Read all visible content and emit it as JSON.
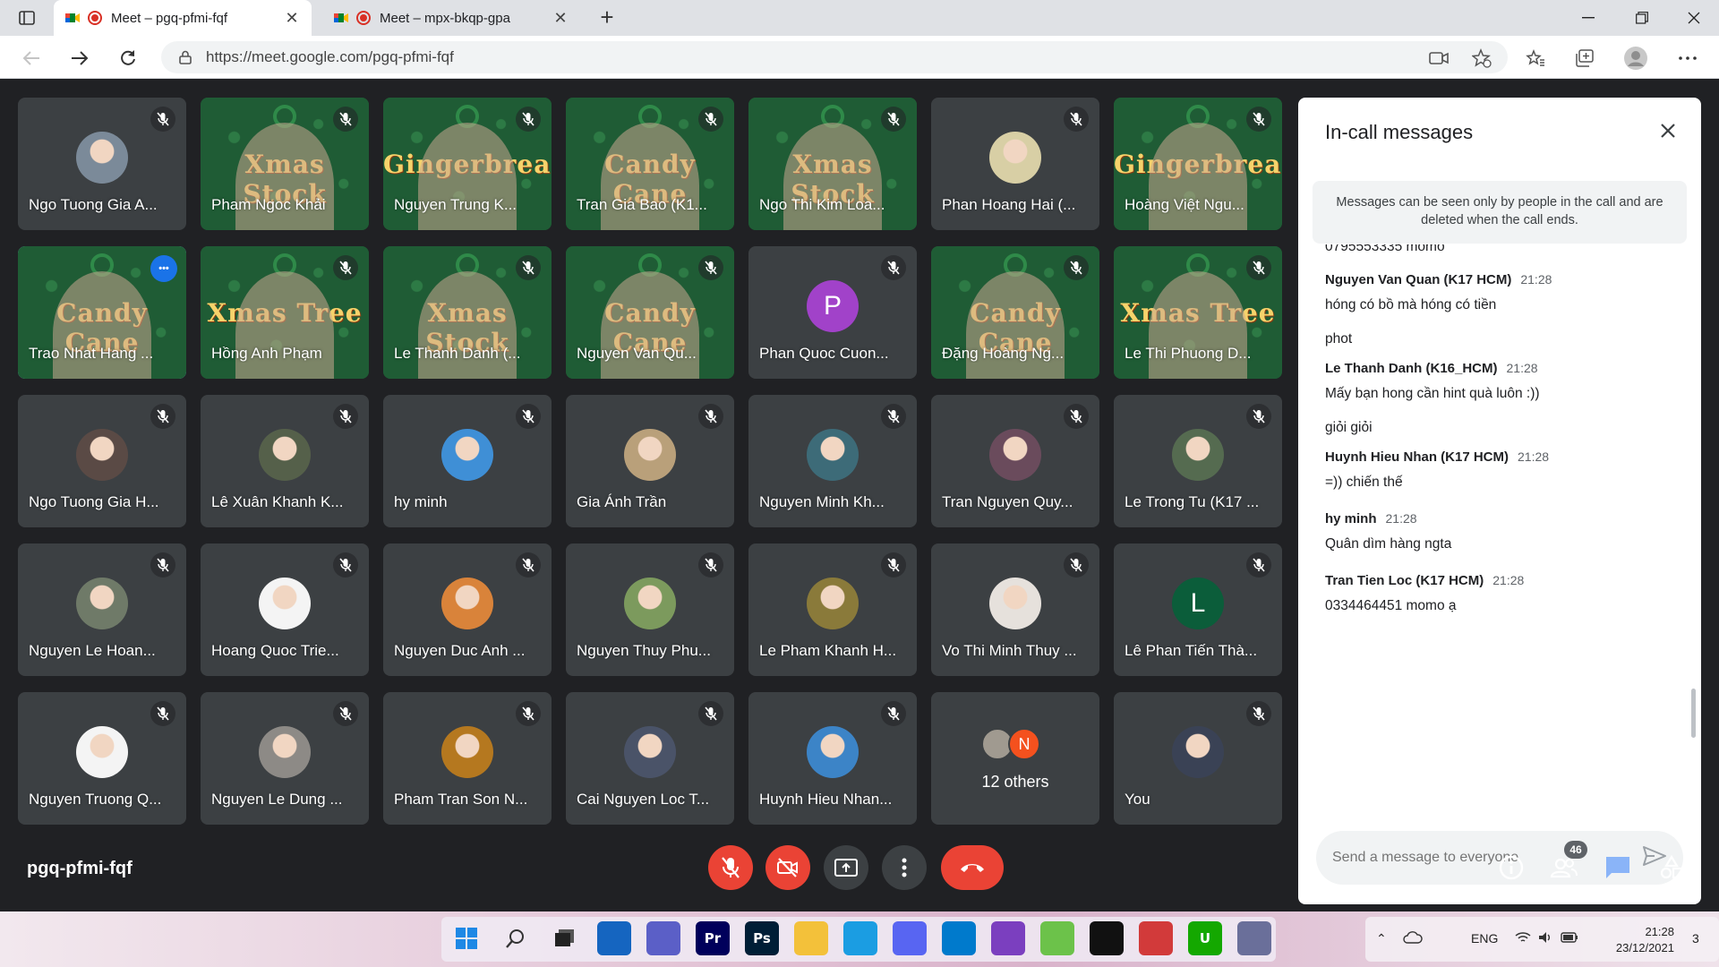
{
  "browser": {
    "tabs": [
      {
        "title": "Meet – pgq-pfmi-fqf",
        "active": true
      },
      {
        "title": "Meet – mpx-bkqp-gpa",
        "active": false
      }
    ],
    "url": "https://meet.google.com/pgq-pfmi-fqf"
  },
  "meeting": {
    "code": "pgq-pfmi-fqf",
    "participant_count": "46",
    "tiles": [
      {
        "name": "Ngo Tuong Gia A...",
        "type": "avatar",
        "color": "#7b8a99"
      },
      {
        "name": "Pham Ngoc Khải",
        "type": "video",
        "banner": "Xmas Stock"
      },
      {
        "name": "Nguyen Trung K...",
        "type": "video",
        "banner": "Gingerbread"
      },
      {
        "name": "Tran Gia Bao (K1...",
        "type": "video",
        "banner": "Candy Cane"
      },
      {
        "name": "Ngo Thi Kim Loa...",
        "type": "video",
        "banner": "Xmas Stock"
      },
      {
        "name": "Phan Hoang Hai (...",
        "type": "avatar",
        "color": "#d8cfa5"
      },
      {
        "name": "Hoàng Việt Ngu...",
        "type": "video",
        "banner": "Gingerbread"
      },
      {
        "name": "Trao Nhat Hang ...",
        "type": "video",
        "banner": "Candy Cane",
        "selected": true
      },
      {
        "name": "Hồng Anh Phạm",
        "type": "video",
        "banner": "Xmas Tree"
      },
      {
        "name": "Le Thanh Danh (...",
        "type": "video",
        "banner": "Xmas Stock"
      },
      {
        "name": "Nguyen Van Qu...",
        "type": "video",
        "banner": "Candy Cane"
      },
      {
        "name": "Phan Quoc Cuon...",
        "type": "letter",
        "letter": "P",
        "color": "#a142c9"
      },
      {
        "name": "Đặng Hoàng Ng...",
        "type": "video",
        "banner": "Candy Cane"
      },
      {
        "name": "Le Thi Phuong D...",
        "type": "video",
        "banner": "Xmas Tree"
      },
      {
        "name": "Ngo Tuong Gia H...",
        "type": "avatar",
        "color": "#5a4a45"
      },
      {
        "name": "Lê Xuân Khanh K...",
        "type": "avatar",
        "color": "#55604a"
      },
      {
        "name": "hy minh",
        "type": "avatar",
        "color": "#3f8fd6"
      },
      {
        "name": "Gia Ánh Trần",
        "type": "avatar",
        "color": "#b9a07a"
      },
      {
        "name": "Nguyen Minh Kh...",
        "type": "avatar",
        "color": "#3d6b78"
      },
      {
        "name": "Tran Nguyen Quy...",
        "type": "avatar",
        "color": "#6a4b5c"
      },
      {
        "name": "Le Trong Tu (K17 ...",
        "type": "avatar",
        "color": "#556b50"
      },
      {
        "name": "Nguyen Le Hoan...",
        "type": "avatar",
        "color": "#6f7a68"
      },
      {
        "name": "Hoang Quoc Trie...",
        "type": "avatar",
        "color": "#f4f4f4"
      },
      {
        "name": "Nguyen Duc Anh ...",
        "type": "avatar",
        "color": "#d9833a"
      },
      {
        "name": "Nguyen Thuy Phu...",
        "type": "avatar",
        "color": "#7c9a5d"
      },
      {
        "name": "Le Pham Khanh H...",
        "type": "avatar",
        "color": "#8a7a3a"
      },
      {
        "name": "Vo Thi Minh Thuy ...",
        "type": "avatar",
        "color": "#e6e1dc"
      },
      {
        "name": "Lê Phan Tiến Thà...",
        "type": "letter",
        "letter": "L",
        "color": "#0b5d3a"
      },
      {
        "name": "Nguyen Truong Q...",
        "type": "avatar",
        "color": "#f4f4f4"
      },
      {
        "name": "Nguyen Le Dung ...",
        "type": "avatar",
        "color": "#8d8a86"
      },
      {
        "name": "Pham Tran Son N...",
        "type": "avatar",
        "color": "#b5781f"
      },
      {
        "name": "Cai Nguyen Loc T...",
        "type": "avatar",
        "color": "#4a5368"
      },
      {
        "name": "Huynh Hieu Nhan...",
        "type": "avatar",
        "color": "#3c84c7"
      },
      {
        "name": "12 others",
        "type": "others",
        "letter": "N"
      },
      {
        "name": "You",
        "type": "avatar",
        "color": "#3a4255"
      }
    ]
  },
  "chat": {
    "title": "In-call messages",
    "notice": "Messages can be seen only by people in the call and are deleted when the call ends.",
    "partial_top": "0795553335 momo",
    "messages": [
      {
        "sender": "Nguyen Van Quan (K17 HCM)",
        "time": "21:28",
        "lines": [
          "hóng có bồ mà hóng có tiền",
          "phot"
        ]
      },
      {
        "sender": "Le Thanh Danh (K16_HCM)",
        "time": "21:28",
        "lines": [
          "Mấy bạn hong cần hint quà luôn :))",
          "giỏi giỏi"
        ]
      },
      {
        "sender": "Huynh Hieu Nhan (K17 HCM)",
        "time": "21:28",
        "lines": [
          "=)) chiến thế"
        ]
      },
      {
        "sender": "hy minh",
        "time": "21:28",
        "lines": [
          "Quân dìm hàng ngta"
        ]
      },
      {
        "sender": "Tran Tien Loc (K17 HCM)",
        "time": "21:28",
        "lines": [
          "0334464451 momo ạ"
        ]
      }
    ],
    "compose_placeholder": "Send a message to everyone"
  },
  "taskbar": {
    "apps": [
      "start-icon",
      "search-icon",
      "task-view-icon",
      "widgets-icon",
      "teams-icon",
      "premiere-icon",
      "photoshop-icon",
      "file-explorer-icon",
      "edge-icon",
      "discord-icon",
      "vscode-icon",
      "visual-studio-icon",
      "git-icon",
      "tiktok-icon",
      "app-icon",
      "upwork-icon",
      "anime-app-icon"
    ],
    "language": "ENG",
    "time": "21:28",
    "date": "23/12/2021",
    "notification_count": "3"
  }
}
